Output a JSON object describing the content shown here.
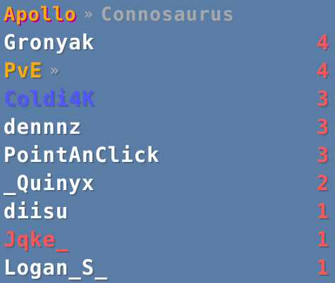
{
  "colors": {
    "gold": "#ffaa00",
    "purple": "#aa00aa",
    "gray": "#a8a8a8",
    "white": "#ffffff",
    "blue": "#5555ff",
    "red": "#ff5555"
  },
  "header": {
    "team": "Apollo",
    "separator": "»",
    "subtitle": "Connosaurus"
  },
  "rows": [
    {
      "name": "Gronyak",
      "score": "4",
      "name_color": "#ffffff",
      "separator": ""
    },
    {
      "name": "PvE",
      "score": "4",
      "name_color": "#ffaa00",
      "separator": "»"
    },
    {
      "name": "Coldi4K",
      "score": "3",
      "name_color": "#5555ff",
      "separator": ""
    },
    {
      "name": "dennnz",
      "score": "3",
      "name_color": "#ffffff",
      "separator": ""
    },
    {
      "name": "PointAnClick",
      "score": "3",
      "name_color": "#ffffff",
      "separator": ""
    },
    {
      "name": "_Quinyx",
      "score": "2",
      "name_color": "#ffffff",
      "separator": ""
    },
    {
      "name": "diisu",
      "score": "1",
      "name_color": "#ffffff",
      "separator": ""
    },
    {
      "name": "Jqke_",
      "score": "1",
      "name_color": "#ff5555",
      "separator": ""
    },
    {
      "name": "Logan_S_",
      "score": "1",
      "name_color": "#ffffff",
      "separator": ""
    }
  ]
}
